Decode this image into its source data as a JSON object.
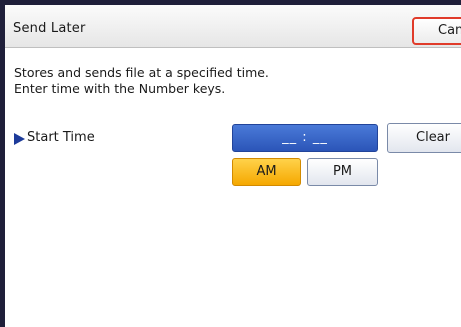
{
  "title": "Send Later",
  "cancel_label": "Cancel",
  "message": [
    "Stores and sends file at a specified time.",
    "Enter time with the Number keys."
  ],
  "start_time": {
    "label": "Start Time",
    "display": "__ : __",
    "clear_label": "Clear",
    "am_label": "AM",
    "pm_label": "PM",
    "selected": "AM"
  },
  "colors": {
    "accent_blue": "#2b55b8",
    "selected_orange": "#f5a800",
    "cancel_border": "#e03b2a"
  }
}
